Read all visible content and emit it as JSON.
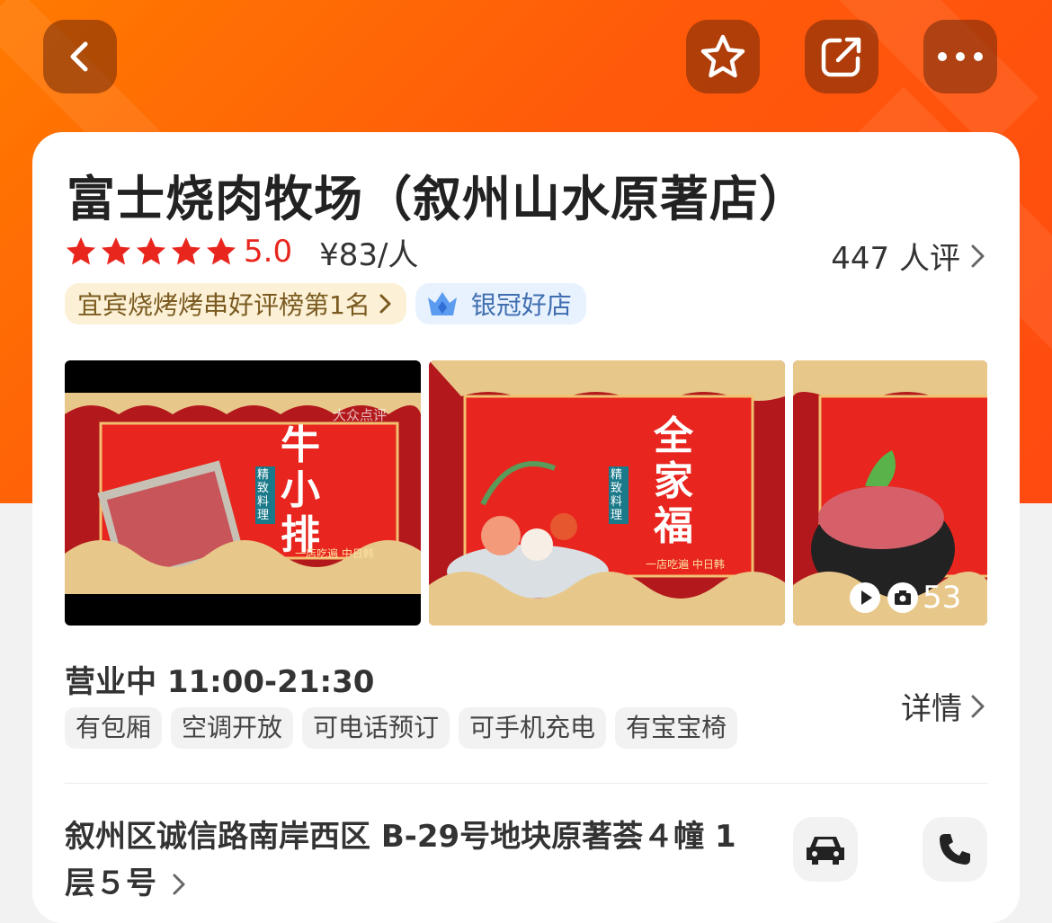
{
  "header": {
    "back_icon": "chevron-left-icon",
    "favorite_icon": "star-icon",
    "share_icon": "share-icon",
    "more_icon": "more-dots-icon"
  },
  "shop": {
    "name": "富士烧肉牧场（叙州山水原著店）",
    "rating": "5.0",
    "stars": 5,
    "price": "¥83/人",
    "reviews": "447 人评",
    "rank_tag": "宜宾烧烤烤串好评榜第1名",
    "crown_tag": "银冠好店"
  },
  "photos": {
    "items": [
      {
        "caption": "牛小排",
        "sub": "精致料理",
        "side": "一店吃遍 中日韩"
      },
      {
        "caption": "全家福",
        "sub": "精致料理",
        "side": "一店吃遍 中日韩"
      },
      {
        "caption": "",
        "sub": "",
        "side": ""
      }
    ],
    "watermark": "大众点评",
    "count": "53"
  },
  "business": {
    "status": "营业中 11:00-21:30",
    "detail_label": "详情",
    "facilities": [
      "有包厢",
      "空调开放",
      "可电话预订",
      "可手机充电",
      "有宝宝椅"
    ]
  },
  "address": {
    "text": "叙州区诚信路南岸西区 B-29号地块原著荟４幢 1层５号"
  },
  "colors": {
    "accent": "#ff5a0a",
    "star": "#e8261d"
  }
}
